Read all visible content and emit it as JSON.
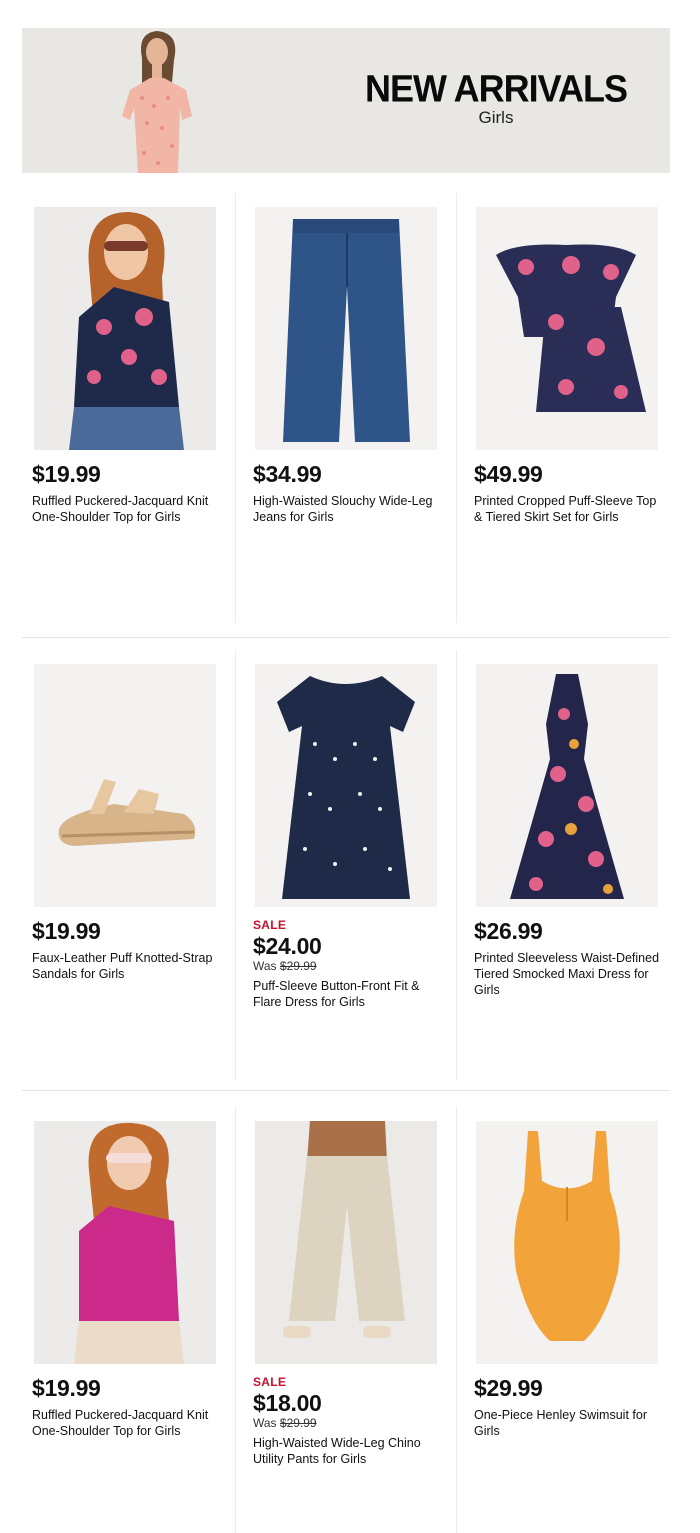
{
  "banner": {
    "title": "NEW ARRIVALS",
    "subtitle": "Girls"
  },
  "products": [
    {
      "price": "$19.99",
      "name": "Ruffled Puckered-Jacquard Knit One-Shoulder Top for Girls"
    },
    {
      "price": "$34.99",
      "name": "High-Waisted Slouchy Wide-Leg Jeans for Girls"
    },
    {
      "price": "$49.99",
      "name": "Printed Cropped Puff-Sleeve Top & Tiered Skirt Set for Girls"
    },
    {
      "price": "$19.99",
      "name": "Faux-Leather Puff Knotted-Strap Sandals for Girls"
    },
    {
      "sale": "SALE",
      "price": "$24.00",
      "was_label": "Was ",
      "was_price": "$29.99",
      "name": "Puff-Sleeve Button-Front Fit & Flare Dress for Girls"
    },
    {
      "price": "$26.99",
      "name": "Printed Sleeveless Waist-Defined Tiered Smocked Maxi Dress for Girls"
    },
    {
      "price": "$19.99",
      "name": "Ruffled Puckered-Jacquard Knit One-Shoulder Top for Girls"
    },
    {
      "sale": "SALE",
      "price": "$18.00",
      "was_label": "Was ",
      "was_price": "$29.99",
      "name": "High-Waisted Wide-Leg Chino Utility Pants for Girls"
    },
    {
      "price": "$29.99",
      "name": "One-Piece Henley Swimsuit for Girls"
    }
  ],
  "colors": {
    "sale": "#c8102e",
    "banner_bg": "#e8e7e4"
  }
}
